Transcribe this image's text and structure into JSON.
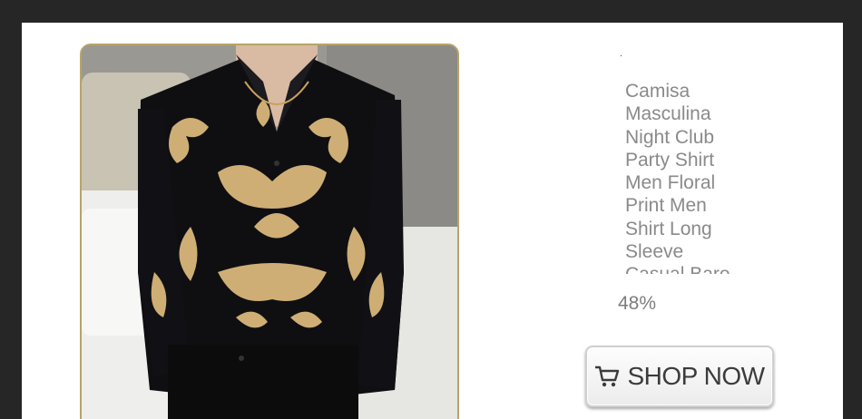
{
  "product": {
    "title": "Camisa Masculina Night Club Party Shirt Men Floral Print Men Shirt Long Sleeve Casual Baro",
    "discount": "48%",
    "shop_button_label": "SHOP NOW",
    "shop_button_icon": "cart-icon",
    "image_alt": "man wearing black shirt with gold baroque floral print"
  },
  "colors": {
    "page_bg": "#262626",
    "card_bg": "#ffffff",
    "frame_border": "#b8a468",
    "text_gray": "#8a8a8a"
  }
}
